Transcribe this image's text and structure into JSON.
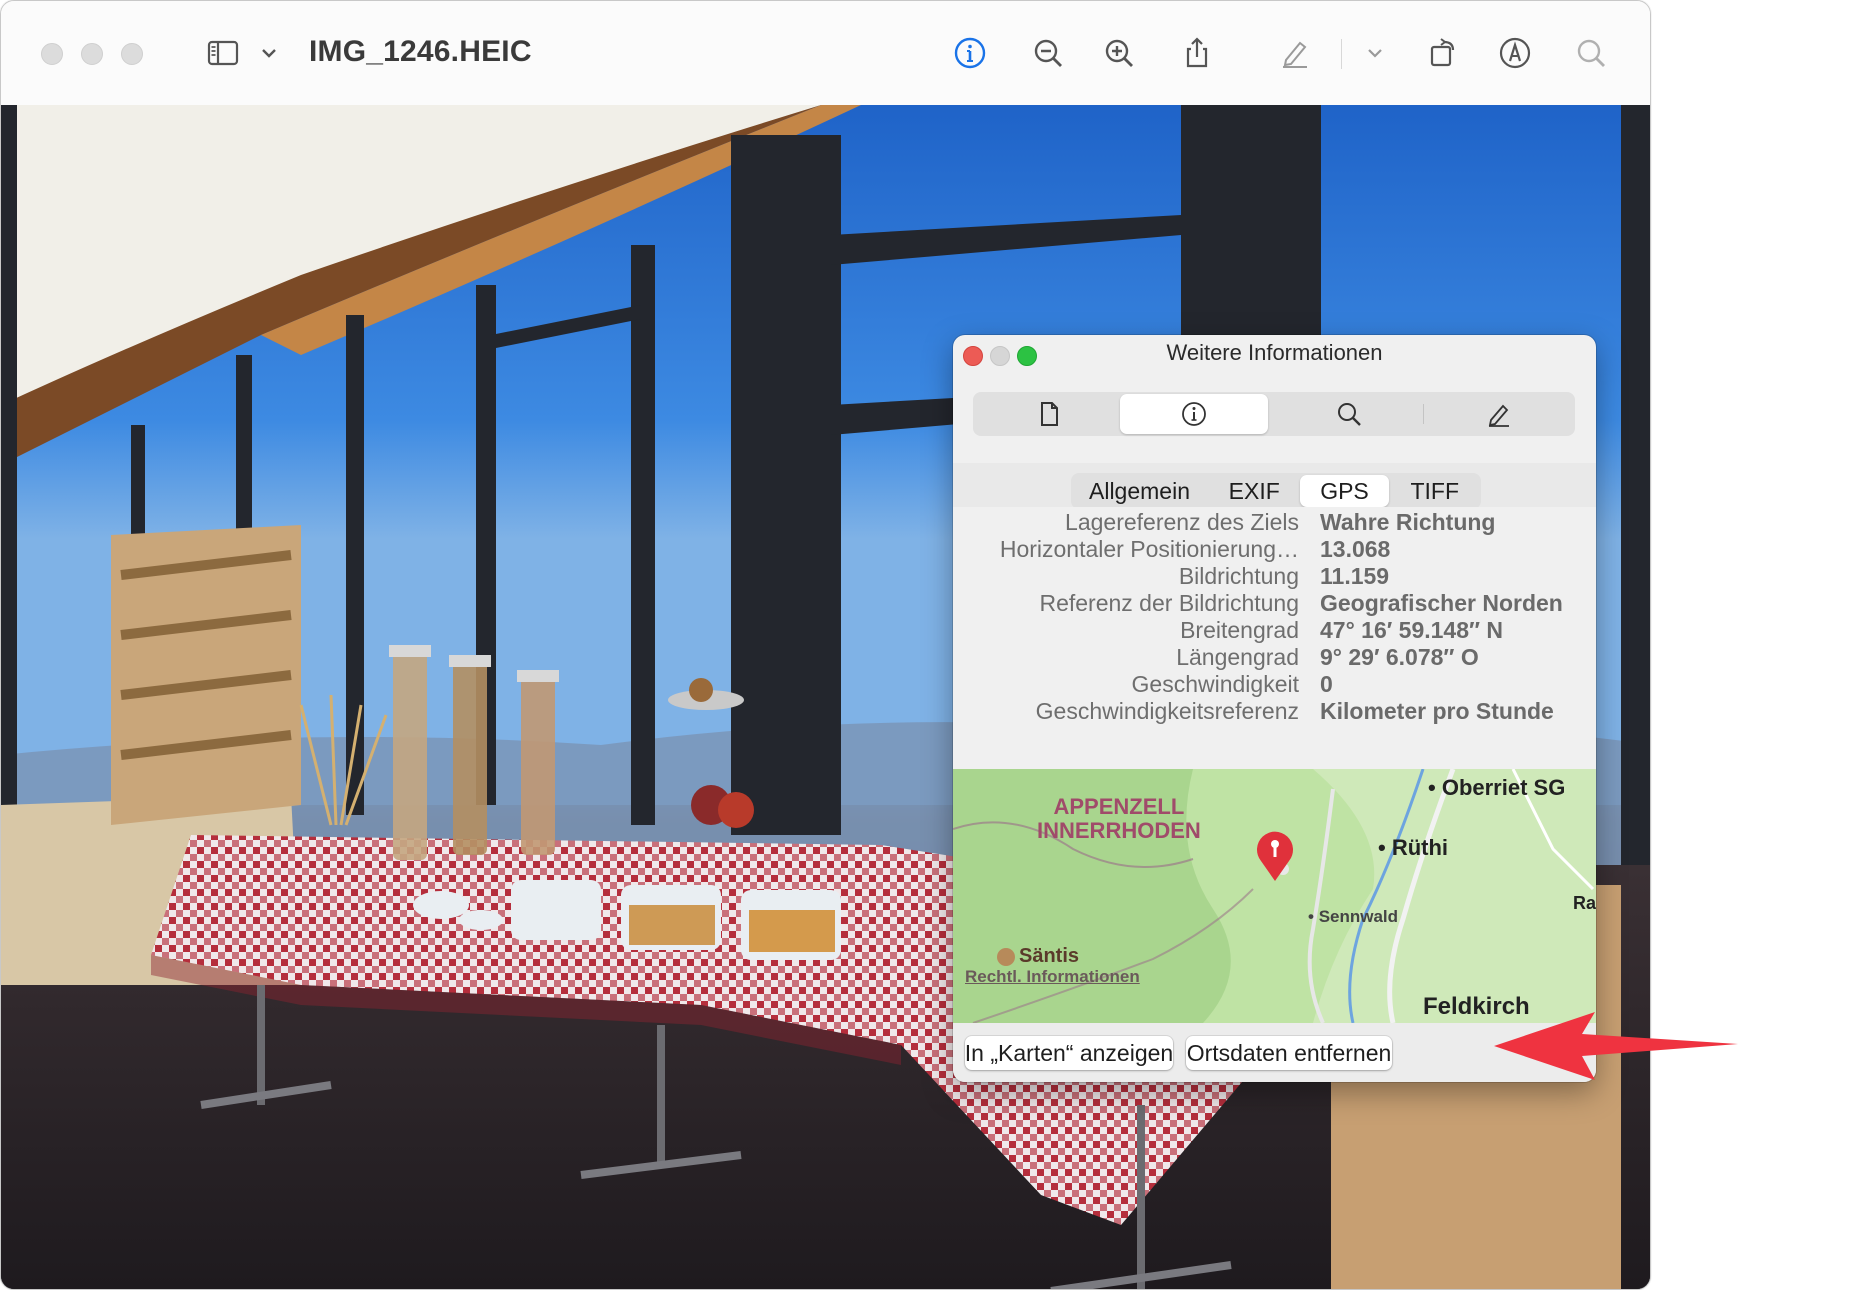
{
  "window": {
    "title": "IMG_1246.HEIC"
  },
  "toolbar": {
    "icons": [
      "sidebar-icon",
      "chevron-down-icon",
      "info-icon",
      "zoom-out-icon",
      "zoom-in-icon",
      "share-icon",
      "markup-pencil-icon",
      "chevron-down-icon",
      "rotate-icon",
      "annotate-icon",
      "search-icon"
    ],
    "accent": "#1a73e8"
  },
  "inspector": {
    "title": "Weitere Informationen",
    "top_tabs": [
      "document-icon",
      "info-icon",
      "search-icon",
      "pencil-icon"
    ],
    "sub_tabs": [
      "Allgemein",
      "EXIF",
      "GPS",
      "TIFF"
    ],
    "active_sub_tab": "GPS",
    "rows": [
      {
        "key": "Lagereferenz des Ziels",
        "value": "Wahre Richtung"
      },
      {
        "key": "Horizontaler Positionierung…",
        "value": "13.068"
      },
      {
        "key": "Bildrichtung",
        "value": "11.159"
      },
      {
        "key": "Referenz der Bildrichtung",
        "value": "Geografischer Norden"
      },
      {
        "key": "Breitengrad",
        "value": "47° 16′ 59.148″ N"
      },
      {
        "key": "Längengrad",
        "value": "9° 29′ 6.078″ O"
      },
      {
        "key": "Geschwindigkeit",
        "value": "0"
      },
      {
        "key": "Geschwindigkeitsreferenz",
        "value": "Kilometer pro Stunde"
      }
    ],
    "map": {
      "region_line1": "APPENZELL",
      "region_line2": "INNERRHODEN",
      "places": [
        "Oberriet SG",
        "Rüthi",
        "Sennwald",
        "Säntis",
        "Feldkirch",
        "Ra"
      ],
      "legal": "Rechtl. Informationen",
      "pin_color": "#e0313b"
    },
    "buttons": {
      "show_in_maps": "In „Karten“ anzeigen",
      "remove_location": "Ortsdaten entfernen"
    }
  },
  "annotation": {
    "arrow_color": "#ef3340"
  }
}
